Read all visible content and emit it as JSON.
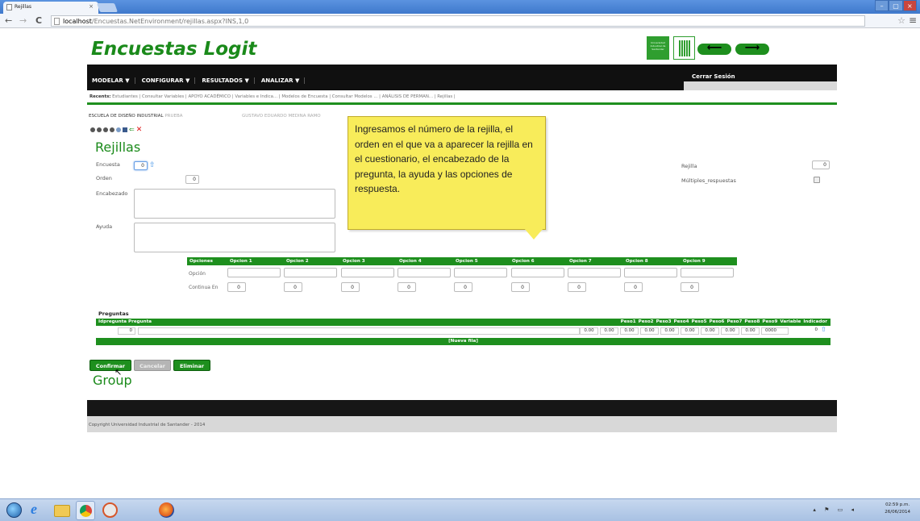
{
  "browser": {
    "tab_title": "Rejillas",
    "tab_close": "×",
    "url_host": "localhost",
    "url_path": "/Encuestas.NetEnvironment/rejillas.aspx?INS,1,0",
    "back": "←",
    "forward": "→",
    "reload": "C",
    "star": "☆",
    "menu": "≡",
    "win_min": "–",
    "win_max": "▢",
    "win_close": "×"
  },
  "header": {
    "app_title": "Encuestas Logit",
    "badge_text": "Universidad Industrial de Santander",
    "back_arrow": "⟵",
    "forward_arrow": "⟶"
  },
  "menubar": {
    "items": [
      "MODELAR ▼",
      "CONFIGURAR ▼",
      "RESULTADOS ▼",
      "ANALIZAR ▼"
    ],
    "logout": "Cerrar Sesión"
  },
  "recents": {
    "label": "Recents:",
    "items": "Estudiantes  |  Consultar Variables  |  APOYO ACADÉMICO  |  Variables e Indica...  |  Modelos de Encuesta  |  Consultar Modelos ...  |  ANÁLISIS DE PERMAN...  |  Rejillas  |"
  },
  "context": {
    "school": "ESCUELA DE DISEÑO INDUSTRIAL",
    "mode": "PRUEBA",
    "user": "GUSTAVO EDUARDO MEDINA RAMO"
  },
  "form": {
    "heading": "Rejillas",
    "encuesta_label": "Encuesta",
    "encuesta_value": "0",
    "orden_label": "Orden",
    "orden_value": "0",
    "encabezado_label": "Encabezado",
    "ayuda_label": "Ayuda",
    "rejilla_label": "Rejilla",
    "rejilla_value": "0",
    "multiples_label": "Múltiples_respuestas"
  },
  "callout": {
    "text": "Ingresamos el número de la rejilla, el orden en el que va a aparecer la rejilla en el cuestionario, el encabezado de la pregunta, la ayuda y las opciones de respuesta."
  },
  "options": {
    "header": [
      "Opciones",
      "Opcion 1",
      "Opcion 2",
      "Opcion 3",
      "Opcion 4",
      "Opcion 5",
      "Opcion 6",
      "Opcion 7",
      "Opcion 8",
      "Opcion 9"
    ],
    "row_opcion": "Opción",
    "row_continua": "Continua En",
    "continua_values": [
      "0",
      "0",
      "0",
      "0",
      "0",
      "0",
      "0",
      "0",
      "0"
    ]
  },
  "preguntas": {
    "title": "Preguntas",
    "header_left": "Idpregunta Pregunta",
    "header_right": [
      "Peso1",
      "Peso2",
      "Peso3",
      "Peso4",
      "Peso5",
      "Peso6",
      "Peso7",
      "Peso8",
      "Peso9",
      "Variable",
      "Indicador"
    ],
    "row_id": "0",
    "row_pesos": [
      "0.00",
      "0.00",
      "0.00",
      "0.00",
      "0.00",
      "0.00",
      "0.00",
      "0.00",
      "0.00"
    ],
    "row_variable": "0000",
    "row_indicador": "0",
    "new_row": "[Nueva fila]"
  },
  "buttons": {
    "confirm": "Confirmar",
    "cancel": "Cancelar",
    "delete": "Eliminar"
  },
  "group_title": "Group",
  "footer": {
    "copyright": "Copyright Universidad Industrial de Santander - 2014"
  },
  "taskbar": {
    "time": "02:59 p.m.",
    "date": "26/06/2014"
  }
}
